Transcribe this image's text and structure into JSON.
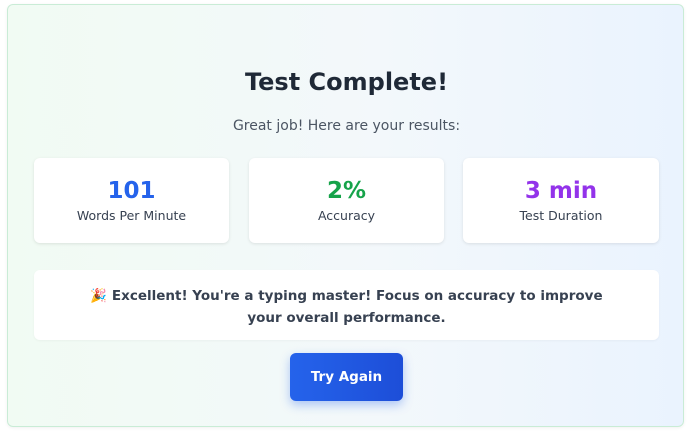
{
  "title": "Test Complete!",
  "subtitle": "Great job! Here are your results:",
  "stats": [
    {
      "value": "101",
      "label": "Words Per Minute",
      "color": "#2563eb"
    },
    {
      "value": "2%",
      "label": "Accuracy",
      "color": "#16a34a"
    },
    {
      "value": "3 min",
      "label": "Test Duration",
      "color": "#9333ea"
    }
  ],
  "message": {
    "icon": "party-popper-icon",
    "emoji": "🎉",
    "text": "Excellent! You're a typing master! Focus on accuracy to improve your overall performance."
  },
  "retry_button": "Try Again"
}
